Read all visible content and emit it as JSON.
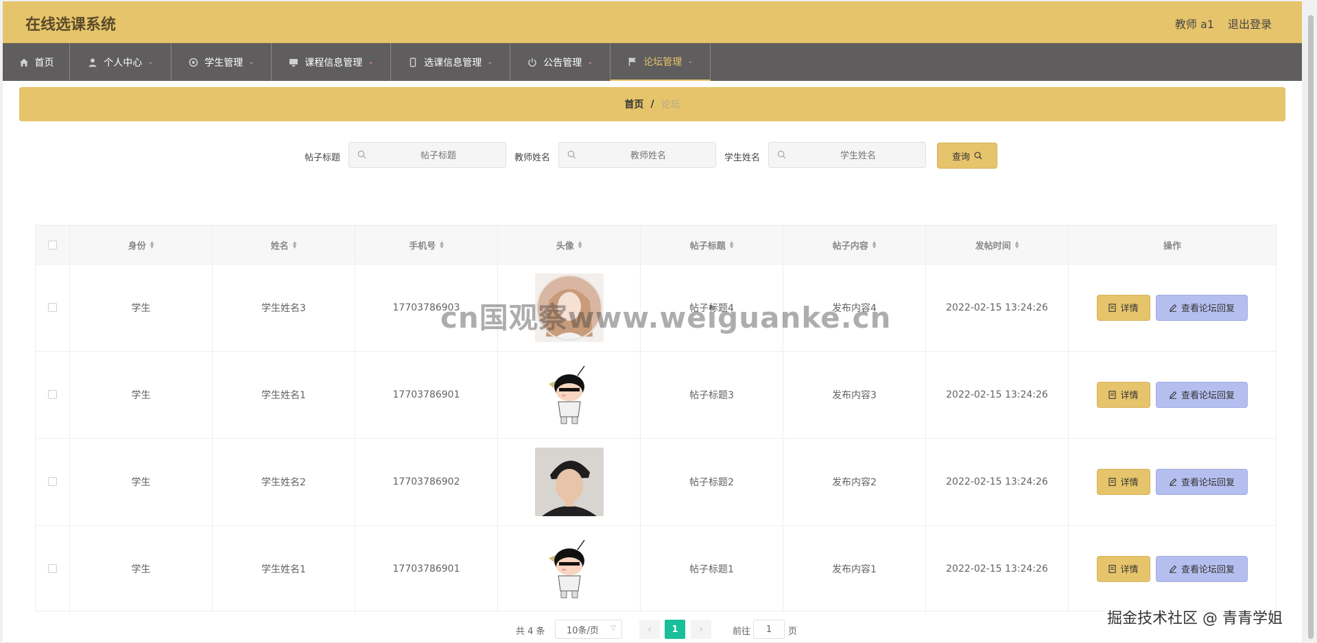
{
  "header": {
    "title": "在线选课系统",
    "user": "教师 a1",
    "logout": "退出登录"
  },
  "nav": [
    {
      "label": "首页",
      "icon": "home-icon",
      "caret": false,
      "active": false
    },
    {
      "label": "个人中心",
      "icon": "user-icon",
      "caret": true,
      "active": false
    },
    {
      "label": "学生管理",
      "icon": "gear-icon",
      "caret": true,
      "active": false
    },
    {
      "label": "课程信息管理",
      "icon": "monitor-icon",
      "caret": true,
      "active": false
    },
    {
      "label": "选课信息管理",
      "icon": "phone-icon",
      "caret": true,
      "active": false
    },
    {
      "label": "公告管理",
      "icon": "power-icon",
      "caret": true,
      "active": false
    },
    {
      "label": "论坛管理",
      "icon": "flag-icon",
      "caret": true,
      "active": true
    }
  ],
  "breadcrumb": {
    "home": "首页",
    "separator": "/",
    "current": "论坛"
  },
  "search": {
    "title_label": "帖子标题",
    "title_placeholder": "帖子标题",
    "teacher_label": "教师姓名",
    "teacher_placeholder": "教师姓名",
    "student_label": "学生姓名",
    "student_placeholder": "学生姓名",
    "query_button": "查询"
  },
  "table": {
    "headers": [
      "身份",
      "姓名",
      "手机号",
      "头像",
      "帖子标题",
      "帖子内容",
      "发帖时间",
      "操作"
    ],
    "rows": [
      {
        "identity": "学生",
        "name": "学生姓名3",
        "phone": "17703786903",
        "avatar": "girl-photo",
        "title": "帖子标题4",
        "content": "发布内容4",
        "time": "2022-02-15 13:24:26"
      },
      {
        "identity": "学生",
        "name": "学生姓名1",
        "phone": "17703786901",
        "avatar": "cartoon-boy",
        "title": "帖子标题3",
        "content": "发布内容3",
        "time": "2022-02-15 13:24:26"
      },
      {
        "identity": "学生",
        "name": "学生姓名2",
        "phone": "17703786902",
        "avatar": "boy-photo",
        "title": "帖子标题2",
        "content": "发布内容2",
        "time": "2022-02-15 13:24:26"
      },
      {
        "identity": "学生",
        "name": "学生姓名1",
        "phone": "17703786901",
        "avatar": "cartoon-boy",
        "title": "帖子标题1",
        "content": "发布内容1",
        "time": "2022-02-15 13:24:26"
      }
    ],
    "detail_button": "详情",
    "reply_button": "查看论坛回复"
  },
  "pagination": {
    "total": "共 4 条",
    "page_size": "10条/页",
    "current_page": "1",
    "goto_label": "前往",
    "goto_value": "1",
    "page_suffix": "页"
  },
  "overlays": {
    "watermark": "cn国观察www.weiguanke.cn",
    "credit": "掘金技术社区 @ 青青学姐"
  },
  "colors": {
    "accent": "#e6c46b",
    "nav_bg": "#5f5d5d",
    "reply_btn": "#b5bfef",
    "page_active": "#19be9a"
  }
}
